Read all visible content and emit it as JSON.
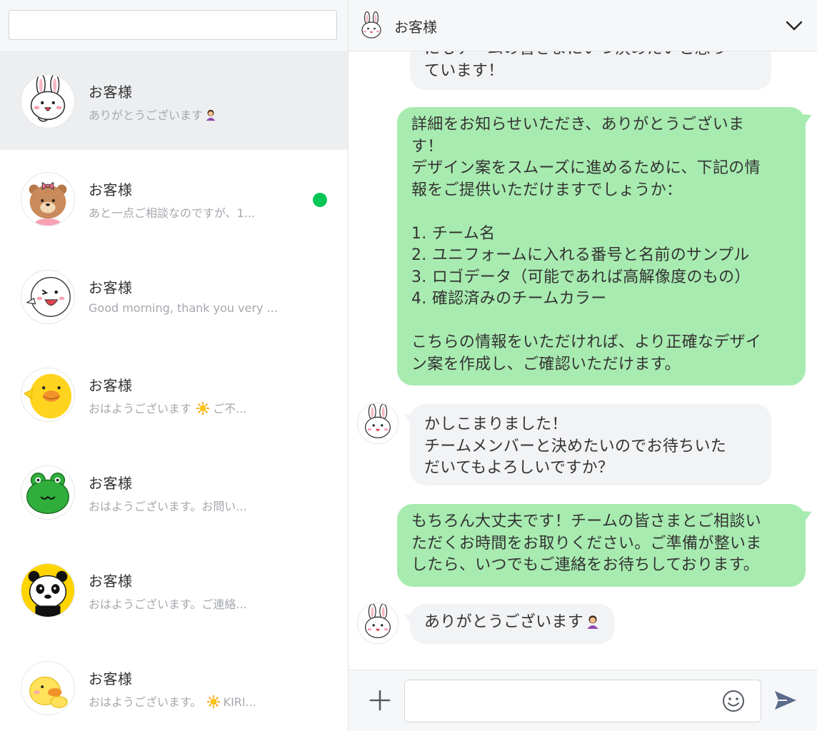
{
  "search": {
    "placeholder": ""
  },
  "chats": [
    {
      "name": "お客様",
      "preview": "ありがとうございます",
      "preview_emoji": "person-bowing-emoji",
      "avatar": "cony-rabbit-icon",
      "selected": true,
      "unread": false
    },
    {
      "name": "お客様",
      "preview": "あと一点ご相談なのですが、1...",
      "avatar": "brown-bear-bow-icon",
      "selected": false,
      "unread": true
    },
    {
      "name": "お客様",
      "preview": "Good morning, thank you very ...",
      "avatar": "moon-character-icon",
      "selected": false,
      "unread": false
    },
    {
      "name": "お客様",
      "preview_pre": "おはようございます",
      "preview_post": "ご不...",
      "preview_emoji": "sun-emoji",
      "avatar": "sally-chick-icon",
      "selected": false,
      "unread": false
    },
    {
      "name": "お客様",
      "preview": "おはようございます。お問い...",
      "avatar": "leonard-frog-icon",
      "selected": false,
      "unread": false
    },
    {
      "name": "お客様",
      "preview": "おはようございます。ご連絡...",
      "avatar": "panda-icon",
      "selected": false,
      "unread": false
    },
    {
      "name": "お客様",
      "preview_pre": "おはようございます。",
      "preview_post": "KIRI...",
      "preview_emoji": "sun-emoji",
      "avatar": "duck-chick-icon",
      "selected": false,
      "unread": false
    }
  ],
  "conversation": {
    "title": "お客様",
    "messages": [
      {
        "side": "in",
        "text": "にもチームの皆さまにいつ決めたいと思っ\nています！",
        "partial": true
      },
      {
        "side": "out",
        "text": "詳細をお知らせいただき、ありがとうございま\nす！\nデザイン案をスムーズに進めるために、下記の情\n報をご提供いただけますでしょうか：\n\n1. チーム名\n2. ユニフォームに入れる番号と名前のサンプル\n3. ロゴデータ（可能であれば高解像度のもの）\n4. 確認済みのチームカラー\n\nこちらの情報をいただければ、より正確なデザイ\nン案を作成し、ご確認いただけます。"
      },
      {
        "side": "in",
        "text": "かしこまりました！\nチームメンバーと決めたいのでお待ちいた\nだいてもよろしいですか？"
      },
      {
        "side": "out",
        "text": "もちろん大丈夫です！チームの皆さまとご相談い\nただくお時間をお取りください。ご準備が整いま\nしたら、いつでもご連絡をお待ちしております。"
      },
      {
        "side": "in",
        "text": "ありがとうございます",
        "emoji": "person-bowing-emoji"
      }
    ]
  },
  "composer": {
    "placeholder": ""
  },
  "colors": {
    "outgoing_bubble": "#a8ebb0",
    "incoming_bubble": "#f2f3f5",
    "unread_dot": "#06c755",
    "header_bg": "#f6f7f8"
  }
}
